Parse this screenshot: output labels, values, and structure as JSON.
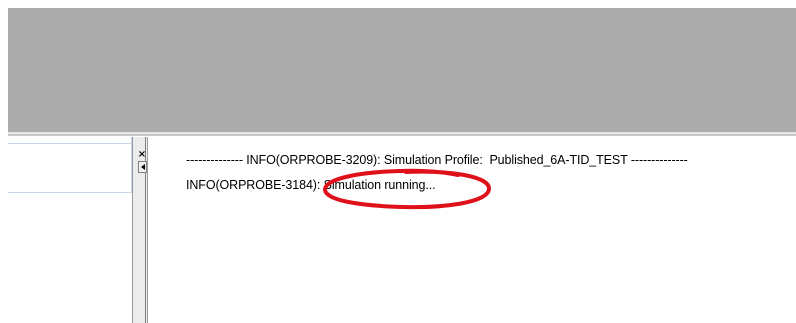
{
  "output": {
    "lines": [
      "-------------- INFO(ORPROBE-3209): Simulation Profile:  Published_6A-TID_TEST --------------",
      "INFO(ORPROBE-3184): Simulation running..."
    ]
  },
  "splitter": {
    "close_glyph": "×",
    "collapse_icon": "left-arrow-icon"
  },
  "annotation": {
    "color": "#e0101a"
  },
  "colors": {
    "workspace": "#ababab",
    "panel": "#ffffff"
  }
}
